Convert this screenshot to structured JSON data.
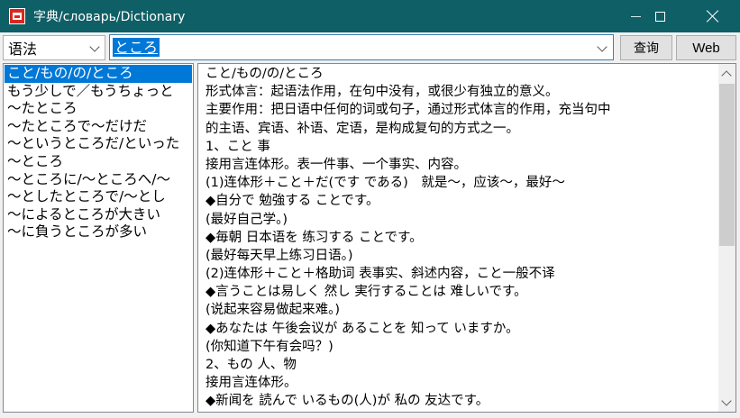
{
  "window": {
    "title": "字典/словарь/Dictionary",
    "icon": "dictionary-app-icon",
    "accent": "#0f5f66"
  },
  "toolbar": {
    "dictionary": "语法",
    "search_value": "ところ",
    "lookup_label": "查询",
    "web_label": "Web"
  },
  "entries": [
    "こと/もの/の/ところ",
    "もう少しで／もうちょっと",
    "～たところ",
    "～たところで～だけだ",
    "～というところだ/といった",
    "～ところ",
    "～ところに/～ところへ/～",
    "～としたところで/～とし",
    "～によるところが大きい",
    "～に負うところが多い"
  ],
  "selected_entry": 0,
  "detail": {
    "lines": [
      "こと/もの/の/ところ",
      "形式体言：起语法作用，在句中没有，或很少有独立的意义。",
      "主要作用：把日语中任何的词或句子，通过形式体言的作用，充当句中",
      "的主语、宾语、补语、定语，是构成复句的方式之一。",
      "1、こと 事",
      "接用言连体形。表一件事、一个事实、内容。",
      "(1)连体形＋こと＋だ(です である)　就是～，应该～，最好～",
      "◆自分で 勉強する ことです。",
      "(最好自己学。)",
      "◆毎朝 日本语を 练习する ことです。",
      "(最好每天早上练习日语。)",
      "(2)连体形＋こと＋格助词 表事实、斜述内容，こと一般不译",
      "◆言うことは易しく 然し 実行することは 难しいです。",
      "(说起来容易做起来难。)",
      "◆あなたは 午後会议が あることを 知って いますか。",
      "(你知道下午有会吗？)",
      "2、もの 人、物",
      "接用言连体形。",
      "◆新闻を 読んで いるもの(人)が 私の 友达です。"
    ]
  }
}
